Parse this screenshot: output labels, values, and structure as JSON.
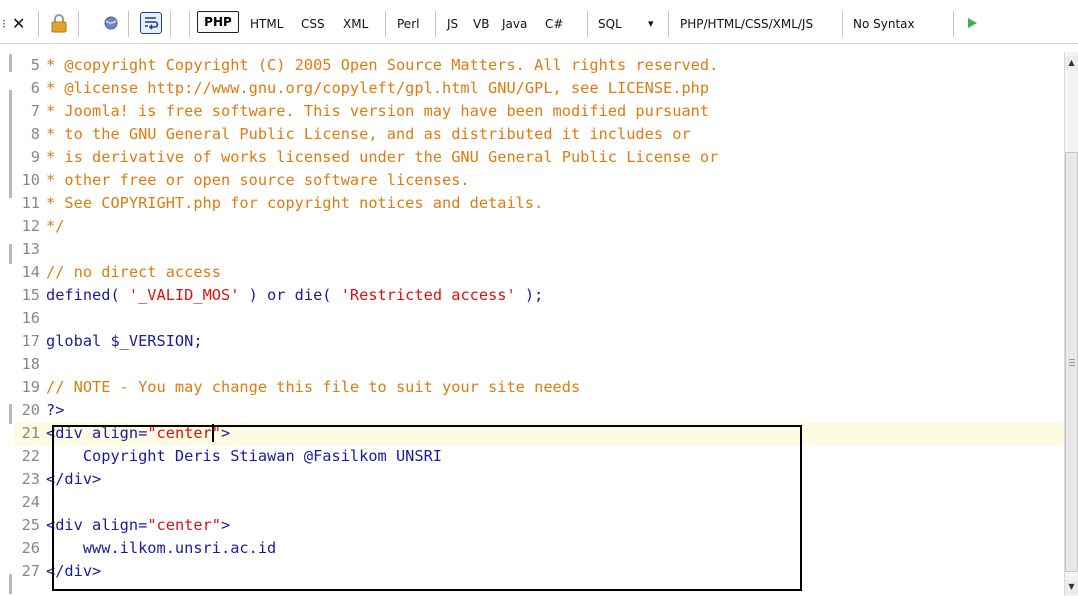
{
  "toolbar": {
    "languages": [
      {
        "label": "PHP",
        "active": true
      },
      {
        "label": "HTML"
      },
      {
        "label": "CSS"
      },
      {
        "label": "XML"
      },
      {
        "label": "Perl"
      },
      {
        "label": "JS"
      },
      {
        "label": "VB"
      },
      {
        "label": "Java"
      },
      {
        "label": "C#"
      },
      {
        "label": "SQL"
      },
      {
        "label": "PHP/HTML/CSS/XML/JS"
      },
      {
        "label": "No Syntax"
      }
    ],
    "sql_dropdown_glyph": "▾",
    "icons": [
      "close-icon",
      "lock-icon",
      "globe-icon",
      "wrap-icon",
      "play-icon"
    ],
    "colors": {
      "play": "#3bb54a",
      "lock": "#e0a52a",
      "globe": "#6f86c7"
    }
  },
  "editor": {
    "cursor_line": 21,
    "lines": [
      {
        "num": "5",
        "segments": [
          {
            "t": "* @copyright Copyright (C) 2005 Open Source Matters. All rights reserved.",
            "c": "comment"
          }
        ]
      },
      {
        "num": "6",
        "segments": [
          {
            "t": "* @license http://www.gnu.org/copyleft/gpl.html GNU/GPL, see LICENSE.php",
            "c": "comment"
          }
        ]
      },
      {
        "num": "7",
        "segments": [
          {
            "t": "* Joomla! is free software. This version may have been modified pursuant",
            "c": "comment"
          }
        ]
      },
      {
        "num": "8",
        "segments": [
          {
            "t": "* to the GNU General Public License, and as distributed it includes or",
            "c": "comment"
          }
        ]
      },
      {
        "num": "9",
        "segments": [
          {
            "t": "* is derivative of works licensed under the GNU General Public License or",
            "c": "comment"
          }
        ]
      },
      {
        "num": "10",
        "segments": [
          {
            "t": "* other free or open source software licenses.",
            "c": "comment"
          }
        ]
      },
      {
        "num": "11",
        "segments": [
          {
            "t": "* See COPYRIGHT.php for copyright notices and details.",
            "c": "comment"
          }
        ]
      },
      {
        "num": "12",
        "segments": [
          {
            "t": "*/",
            "c": "comment"
          }
        ]
      },
      {
        "num": "13",
        "segments": []
      },
      {
        "num": "14",
        "segments": [
          {
            "t": "// no direct access",
            "c": "comment"
          }
        ]
      },
      {
        "num": "15",
        "segments": [
          {
            "t": "defined( ",
            "c": "func"
          },
          {
            "t": "'_VALID_MOS'",
            "c": "str"
          },
          {
            "t": " ) or die( ",
            "c": "func"
          },
          {
            "t": "'Restricted access'",
            "c": "str"
          },
          {
            "t": " );",
            "c": "func"
          }
        ]
      },
      {
        "num": "16",
        "segments": []
      },
      {
        "num": "17",
        "segments": [
          {
            "t": "global $_VERSION;",
            "c": "func"
          }
        ]
      },
      {
        "num": "18",
        "segments": []
      },
      {
        "num": "19",
        "segments": [
          {
            "t": "// NOTE - You may change this file to suit your site needs",
            "c": "comment"
          }
        ]
      },
      {
        "num": "20",
        "segments": [
          {
            "t": "?>",
            "c": "func"
          }
        ]
      },
      {
        "num": "21",
        "segments": [
          {
            "t": "<div align=",
            "c": "tag"
          },
          {
            "t": "\"center\"",
            "c": "str"
          },
          {
            "t": ">",
            "c": "tag"
          }
        ]
      },
      {
        "num": "22",
        "segments": [
          {
            "t": "    Copyright Deris Stiawan @Fasilkom UNSRI",
            "c": "text"
          }
        ]
      },
      {
        "num": "23",
        "segments": [
          {
            "t": "</div>",
            "c": "tag"
          }
        ]
      },
      {
        "num": "24",
        "segments": []
      },
      {
        "num": "25",
        "segments": [
          {
            "t": "<div align=",
            "c": "tag"
          },
          {
            "t": "\"center\"",
            "c": "str"
          },
          {
            "t": ">",
            "c": "tag"
          }
        ]
      },
      {
        "num": "26",
        "segments": [
          {
            "t": "    www.ilkom.unsri.ac.id",
            "c": "text"
          }
        ]
      },
      {
        "num": "27",
        "segments": [
          {
            "t": "</div>",
            "c": "tag"
          }
        ]
      }
    ]
  }
}
